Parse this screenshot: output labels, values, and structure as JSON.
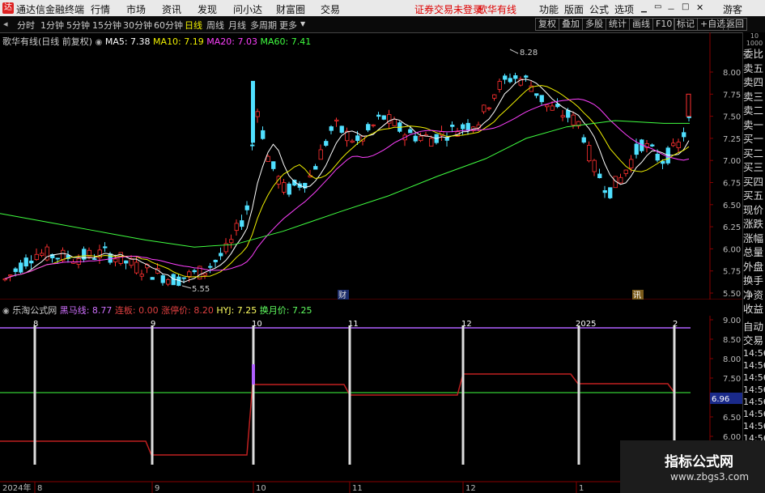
{
  "menubar": {
    "app_title": "通达信金融终端",
    "items": [
      "行情",
      "市场",
      "资讯",
      "发现",
      "问小达",
      "财富圈",
      "交易"
    ],
    "login": "证券交易未登录",
    "stock": "歌华有线",
    "right": [
      "功能",
      "版面",
      "公式",
      "选项"
    ],
    "guest": "游客"
  },
  "toolbar": {
    "periods": [
      "分时",
      "1分钟",
      "5分钟",
      "15分钟",
      "30分钟",
      "60分钟",
      "日线",
      "周线",
      "月线",
      "多周期",
      "更多"
    ],
    "active": "日线",
    "right": [
      "复权",
      "叠加",
      "多股",
      "统计",
      "画线",
      "F10",
      "标记",
      "+自选",
      "返回"
    ]
  },
  "main_chart": {
    "name": "歌华有线(日线 前复权)",
    "ma": [
      {
        "label": "MA5: 7.38",
        "color": "#ffffff"
      },
      {
        "label": "MA10: 7.19",
        "color": "#f0f000"
      },
      {
        "label": "MA20: 7.03",
        "color": "#ff40ff"
      },
      {
        "label": "MA60: 7.41",
        "color": "#40ff40"
      }
    ],
    "yticks": [
      "8.00",
      "7.75",
      "7.50",
      "7.25",
      "7.00",
      "6.75",
      "6.50",
      "6.25",
      "6.00",
      "5.75",
      "5.50"
    ],
    "annot_high": "8.28",
    "annot_low": "5.55",
    "marker_cai": "财",
    "marker_xun": "讯"
  },
  "sub_chart": {
    "name": "乐淘公式网",
    "items": [
      {
        "label": "黑马线: 8.77",
        "color": "#d070ff"
      },
      {
        "label": "连板: 0.00",
        "color": "#e04040"
      },
      {
        "label": "涨停价: 8.20",
        "color": "#e04040"
      },
      {
        "label": "HYJ: 7.25",
        "color": "#ffff60"
      },
      {
        "label": "换月价: 7.25",
        "color": "#60ff60"
      }
    ],
    "yticks": [
      "9.00",
      "8.50",
      "8.00",
      "7.50",
      "7.00",
      "6.50",
      "6.00"
    ],
    "month_labels": [
      "8",
      "9",
      "10",
      "11",
      "12",
      "2025",
      "2"
    ],
    "price_tag": "6.96"
  },
  "xaxis": {
    "labels": [
      "2024年",
      "8",
      "9",
      "10",
      "11",
      "12",
      "1"
    ]
  },
  "right_panel": {
    "items": [
      "委比",
      "卖五",
      "卖四",
      "卖三",
      "卖二",
      "卖一",
      "买一",
      "买二",
      "买三",
      "买四",
      "买五",
      "现价",
      "涨跌",
      "涨幅",
      "总量",
      "外盘",
      "换手",
      "净资",
      "收益"
    ],
    "items2": [
      "自动",
      "交易",
      "14:56",
      "14:56",
      "14:56",
      "14:56",
      "14:56",
      "14:56",
      "14:56",
      "14:56",
      "14:56",
      "14:56"
    ],
    "header": "10",
    "header2": "1000"
  },
  "watermark": {
    "title": "指标公式网",
    "url": "www.zbgs3.com"
  }
}
